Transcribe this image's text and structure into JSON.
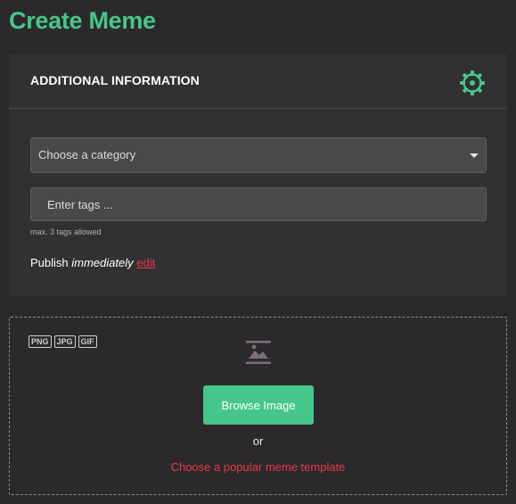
{
  "page": {
    "title": "Create Meme"
  },
  "info": {
    "title": "ADDITIONAL INFORMATION",
    "settings_icon": "gear-icon",
    "category": {
      "placeholder": "Choose a category"
    },
    "tags": {
      "placeholder": "Enter tags ...",
      "hint": "max. 3 tags allowed"
    },
    "publish": {
      "prefix": "Publish ",
      "mode": "immediately",
      "edit": "edit"
    }
  },
  "upload": {
    "formats": [
      "PNG",
      "JPG",
      "GIF"
    ],
    "icon": "image-upload-icon",
    "browse_label": "Browse Image",
    "or_text": "or",
    "template_link": "Choose a popular meme template"
  },
  "colors": {
    "accent": "#45c78b",
    "link": "#e8394a",
    "background": "#2b292b",
    "card": "#323032"
  }
}
